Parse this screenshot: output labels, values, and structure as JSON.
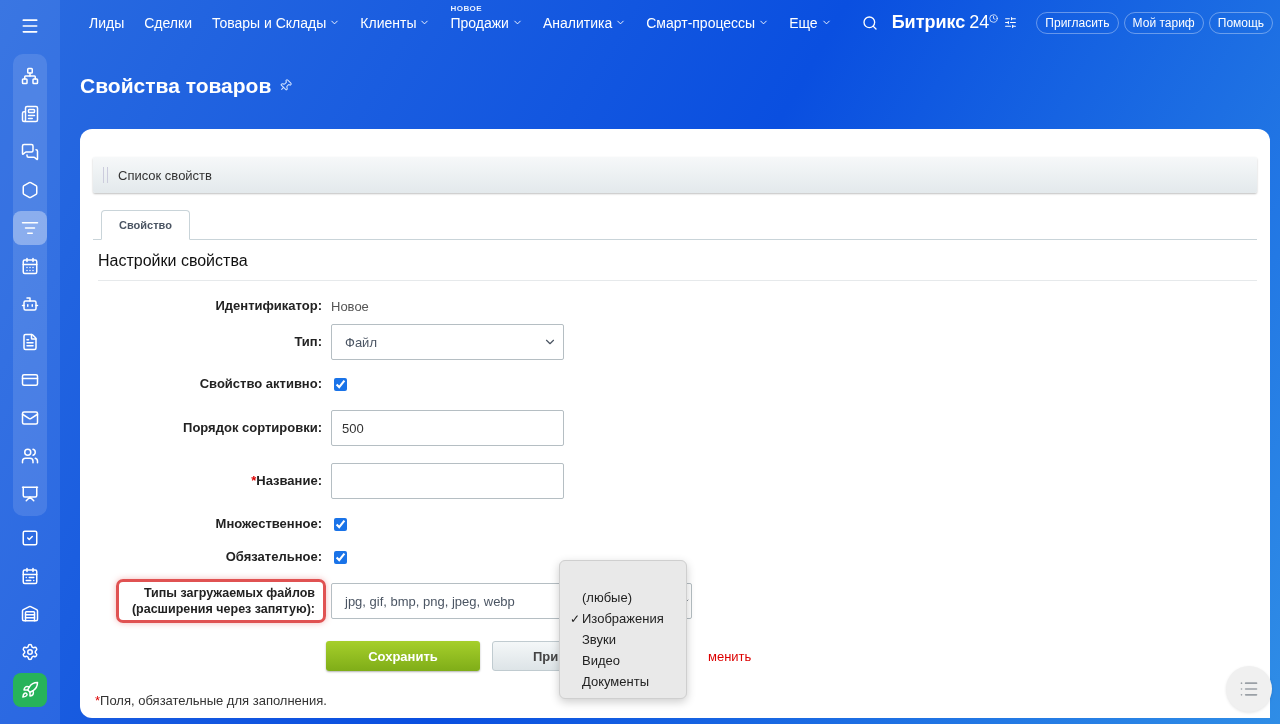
{
  "sidebar": {
    "items": [
      {
        "selected": false
      },
      {
        "selected": false
      },
      {
        "selected": false
      },
      {
        "selected": false
      },
      {
        "selected": true
      },
      {
        "selected": false
      },
      {
        "selected": false
      },
      {
        "selected": false
      },
      {
        "selected": false
      },
      {
        "selected": false
      },
      {
        "selected": false
      },
      {
        "selected": false
      },
      {
        "selected": false
      },
      {
        "selected": false
      },
      {
        "selected": false
      },
      {
        "selected": false
      },
      {
        "selected": false
      }
    ]
  },
  "nav": {
    "items": [
      {
        "label": "Лиды",
        "dropdown": false
      },
      {
        "label": "Сделки",
        "dropdown": false
      },
      {
        "label": "Товары и Склады",
        "dropdown": true
      },
      {
        "label": "Клиенты",
        "dropdown": true
      },
      {
        "label": "Продажи",
        "dropdown": true,
        "badge": "НОВОЕ"
      },
      {
        "label": "Аналитика",
        "dropdown": true
      },
      {
        "label": "Смарт-процессы",
        "dropdown": true
      },
      {
        "label": "Еще",
        "dropdown": true
      }
    ],
    "logo": "Битрикс",
    "logo_suffix": "24",
    "buttons": [
      "Пригласить",
      "Мой тариф",
      "Помощь"
    ]
  },
  "page_title": "Свойства товаров",
  "list_header": "Список свойств",
  "tabs": [
    {
      "label": "Свойство",
      "selected": true
    }
  ],
  "section_title": "Настройки свойства",
  "fields": [
    {
      "kind": "text",
      "label": "Идентификатор:",
      "value": "Новое"
    },
    {
      "kind": "select",
      "label": "Тип:",
      "value": "Файл"
    },
    {
      "kind": "checkbox",
      "label": "Свойство активно:",
      "checked": true
    },
    {
      "kind": "input",
      "label": "Порядок сортировки:",
      "value": "500"
    },
    {
      "kind": "input",
      "label": "Название:",
      "marker": "*"
    },
    {
      "kind": "checkbox",
      "label": "Множественное:",
      "checked": true
    },
    {
      "kind": "checkbox",
      "label": "Обязательное:",
      "checked": true
    },
    {
      "kind": "wideselect",
      "label": "Типы загружаемых файлов (расширения через запятую):",
      "value": "jpg, gif, bmp, png, jpeg, webp",
      "highlighted": true
    }
  ],
  "buttons": {
    "save": "Сохранить",
    "apply": "При",
    "cancel": "менить"
  },
  "dropdown": {
    "options": [
      {
        "label": "(любые)",
        "selected": false
      },
      {
        "label": "Изображения",
        "selected": true
      },
      {
        "label": "Звуки",
        "selected": false
      },
      {
        "label": "Видео",
        "selected": false
      },
      {
        "label": "Документы",
        "selected": false
      }
    ],
    "check": "✓"
  },
  "footnote": {
    "marker": "*",
    "text": "Поля, обязательные для заполнения."
  }
}
